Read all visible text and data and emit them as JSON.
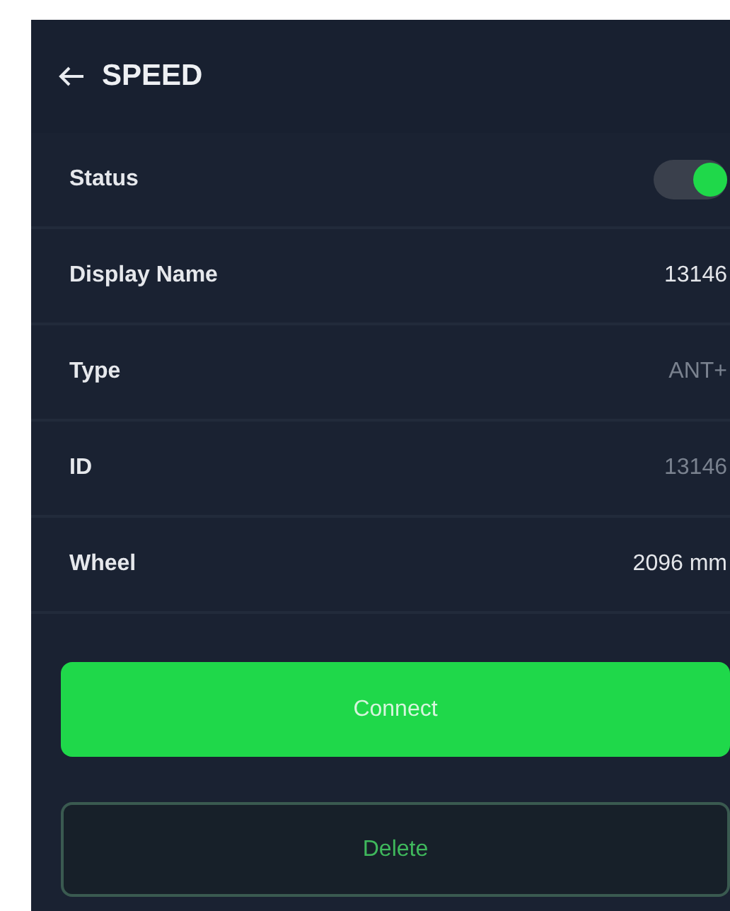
{
  "header": {
    "title": "SPEED"
  },
  "rows": [
    {
      "kind": "toggle",
      "label": "Status",
      "on": true
    },
    {
      "kind": "value",
      "label": "Display Name",
      "value": "13146",
      "dimmed": false
    },
    {
      "kind": "value",
      "label": "Type",
      "value": "ANT+",
      "dimmed": true
    },
    {
      "kind": "value",
      "label": "ID",
      "value": "13146",
      "dimmed": true
    },
    {
      "kind": "value",
      "label": "Wheel",
      "value": "2096 mm",
      "dimmed": false
    }
  ],
  "buttons": [
    {
      "kind": "primary",
      "label": "Connect"
    },
    {
      "kind": "outline",
      "label": "Delete"
    }
  ]
}
